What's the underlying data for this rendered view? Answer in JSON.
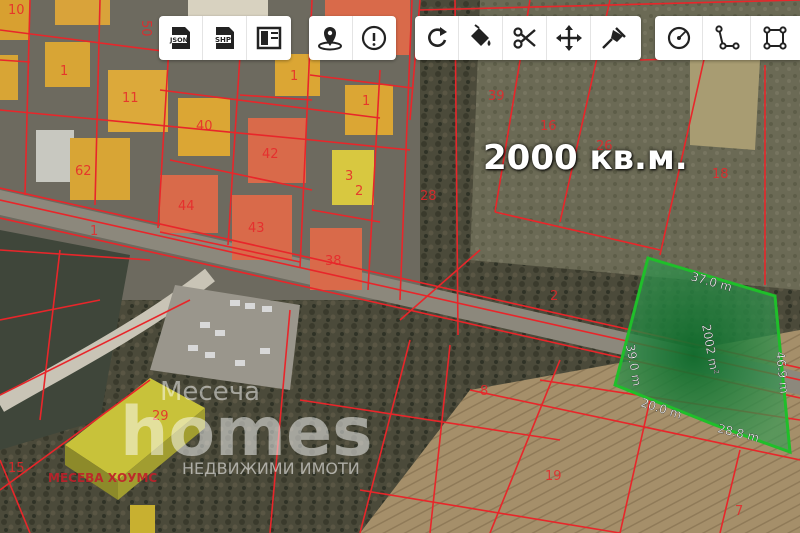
{
  "toolbar": {
    "export": [
      {
        "name": "export-json-icon",
        "label": "JSON"
      },
      {
        "name": "export-shp-icon",
        "label": "SHP"
      },
      {
        "name": "layout-icon",
        "label": ""
      }
    ],
    "info": [
      {
        "name": "locate-icon"
      },
      {
        "name": "info-icon"
      }
    ],
    "edit": [
      {
        "name": "undo-icon"
      },
      {
        "name": "fill-icon"
      },
      {
        "name": "cut-icon"
      },
      {
        "name": "move-icon"
      },
      {
        "name": "pin-icon"
      }
    ],
    "draw": [
      {
        "name": "draw-circle-icon"
      },
      {
        "name": "draw-line-icon"
      },
      {
        "name": "draw-square-icon"
      }
    ]
  },
  "overlay": {
    "area_text": "2000 кв.м."
  },
  "plot": {
    "area": "2002 m²",
    "sides": [
      "37.0 m",
      "39.0 m",
      "46.9 m",
      "20.0 m",
      "28.8 m"
    ]
  },
  "parcel_numbers": [
    "50",
    "10",
    "1",
    "42",
    "1",
    "40",
    "11",
    "1",
    "62",
    "44",
    "43",
    "38",
    "39",
    "26",
    "18",
    "16",
    "28",
    "29",
    "3",
    "2",
    "1",
    "2",
    "19",
    "7",
    "8",
    "15",
    "2"
  ],
  "watermark": {
    "brand_small": "Месеча",
    "brand_big": "homes",
    "brand_left": "МЕСЕВА ХОУМС",
    "brand_right": "НЕДВИЖИМИ ИМОТИ"
  },
  "colors": {
    "parcel_line": "#e8262a",
    "plot_outline": "#1fbf2a",
    "plot_fill": "#2a8a3a"
  }
}
